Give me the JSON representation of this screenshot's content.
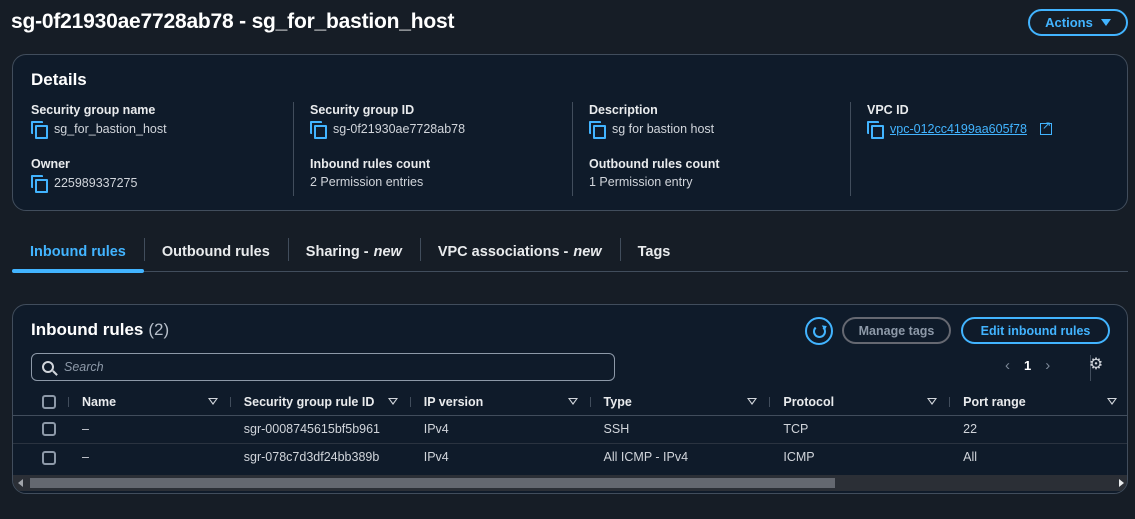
{
  "header": {
    "title": "sg-0f21930ae7728ab78 - sg_for_bastion_host",
    "actions_label": "Actions"
  },
  "details": {
    "title": "Details",
    "security_group_name_label": "Security group name",
    "security_group_name": "sg_for_bastion_host",
    "security_group_id_label": "Security group ID",
    "security_group_id": "sg-0f21930ae7728ab78",
    "description_label": "Description",
    "description": "sg for bastion host",
    "vpc_id_label": "VPC ID",
    "vpc_id": "vpc-012cc4199aa605f78",
    "owner_label": "Owner",
    "owner": "225989337275",
    "inbound_count_label": "Inbound rules count",
    "inbound_count": "2 Permission entries",
    "outbound_count_label": "Outbound rules count",
    "outbound_count": "1 Permission entry"
  },
  "tabs": [
    {
      "label": "Inbound rules",
      "suffix": ""
    },
    {
      "label": "Outbound rules",
      "suffix": ""
    },
    {
      "label": "Sharing -",
      "suffix": "new"
    },
    {
      "label": "VPC associations -",
      "suffix": "new"
    },
    {
      "label": "Tags",
      "suffix": ""
    }
  ],
  "inbound": {
    "title": "Inbound rules",
    "count": "(2)",
    "manage_tags_label": "Manage tags",
    "edit_label": "Edit inbound rules",
    "search_placeholder": "Search",
    "page": "1",
    "columns": [
      "Name",
      "Security group rule ID",
      "IP version",
      "Type",
      "Protocol",
      "Port range"
    ],
    "rows": [
      {
        "name": "–",
        "rule_id": "sgr-0008745615bf5b961",
        "ip_version": "IPv4",
        "type": "SSH",
        "protocol": "TCP",
        "port_range": "22"
      },
      {
        "name": "–",
        "rule_id": "sgr-078c7d3df24bb389b",
        "ip_version": "IPv4",
        "type": "All ICMP - IPv4",
        "protocol": "ICMP",
        "port_range": "All"
      }
    ]
  },
  "icons": {
    "actions_caret": "caret-down-icon",
    "copy": "copy-icon",
    "external_link": "external-link-icon",
    "refresh": "refresh-icon",
    "search": "search-icon",
    "settings": "gear-icon"
  },
  "colors": {
    "accent": "#42b4ff",
    "background": "#161d26",
    "panel": "#0f1b2a",
    "border": "#414d5c"
  }
}
